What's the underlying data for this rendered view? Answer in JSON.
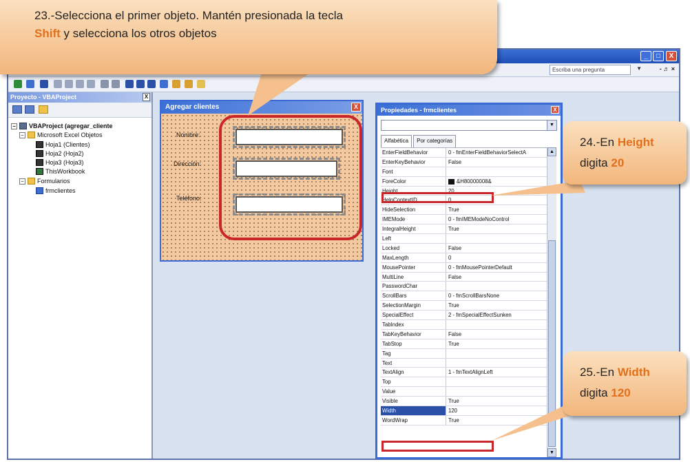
{
  "ide": {
    "ask_placeholder": "Escriba una pregunta",
    "min_btn": "_",
    "max_btn": "□",
    "close_btn": "X",
    "mdi_controls": "- ♬ ×"
  },
  "project": {
    "title": "Proyecto - VBAProject",
    "close": "X",
    "tree": {
      "root": "VBAProject (agregar_cliente",
      "excel_objects": "Microsoft Excel Objetos",
      "sheets": [
        "Hoja1 (Clientes)",
        "Hoja2 (Hoja2)",
        "Hoja3 (Hoja3)"
      ],
      "workbook": "ThisWorkbook",
      "forms_folder": "Formularios",
      "form": "frmclientes"
    }
  },
  "userform": {
    "title": "Agregar clientes",
    "close": "X",
    "labels": [
      "Nombre:",
      "Dirección:",
      "Teléfono:"
    ]
  },
  "properties": {
    "title": "Propiedades - frmclientes",
    "close": "X",
    "tabs": [
      "Alfabética",
      "Por categorías"
    ],
    "rows": [
      {
        "name": "EnterFieldBehavior",
        "value": "0 - fmEnterFieldBehaviorSelectA"
      },
      {
        "name": "EnterKeyBehavior",
        "value": "False"
      },
      {
        "name": "Font",
        "value": ""
      },
      {
        "name": "ForeColor",
        "value": "&H80000008&"
      },
      {
        "name": "Height",
        "value": "20"
      },
      {
        "name": "HelpContextID",
        "value": "0"
      },
      {
        "name": "HideSelection",
        "value": "True"
      },
      {
        "name": "IMEMode",
        "value": "0 - fmIMEModeNoControl"
      },
      {
        "name": "IntegralHeight",
        "value": "True"
      },
      {
        "name": "Left",
        "value": ""
      },
      {
        "name": "Locked",
        "value": "False"
      },
      {
        "name": "MaxLength",
        "value": "0"
      },
      {
        "name": "MousePointer",
        "value": "0 - fmMousePointerDefault"
      },
      {
        "name": "MultiLine",
        "value": "False"
      },
      {
        "name": "PasswordChar",
        "value": ""
      },
      {
        "name": "ScrollBars",
        "value": "0 - fmScrollBarsNone"
      },
      {
        "name": "SelectionMargin",
        "value": "True"
      },
      {
        "name": "SpecialEffect",
        "value": "2 - fmSpecialEffectSunken"
      },
      {
        "name": "TabIndex",
        "value": ""
      },
      {
        "name": "TabKeyBehavior",
        "value": "False"
      },
      {
        "name": "TabStop",
        "value": "True"
      },
      {
        "name": "Tag",
        "value": ""
      },
      {
        "name": "Text",
        "value": ""
      },
      {
        "name": "TextAlign",
        "value": "1 - fmTextAlignLeft"
      },
      {
        "name": "Top",
        "value": ""
      },
      {
        "name": "Value",
        "value": ""
      },
      {
        "name": "Visible",
        "value": "True"
      },
      {
        "name": "Width",
        "value": "120"
      },
      {
        "name": "WordWrap",
        "value": "True"
      }
    ]
  },
  "callouts": {
    "step23_line1": "23.-Selecciona el primer objeto. Mantén presionada la tecla",
    "step23_kw": "Shift",
    "step23_line2": " y selecciona los otros objetos",
    "step24_pre": "24.-En ",
    "step24_kw": "Height",
    "step24_mid": "digita ",
    "step24_val": "20",
    "step25_pre": "25.-En ",
    "step25_kw": "Width",
    "step25_mid": "digita ",
    "step25_val": "120"
  },
  "colors": {
    "callout_keyword": "#e2701b",
    "highlight_red": "#c9262c",
    "titlebar_blue": "#3b6fd6"
  }
}
